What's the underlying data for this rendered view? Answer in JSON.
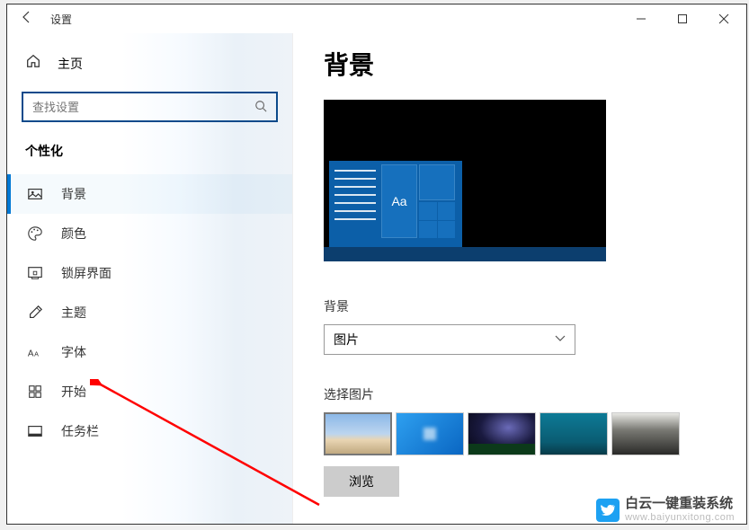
{
  "titlebar": {
    "title": "设置"
  },
  "sidebar": {
    "home": "主页",
    "search_placeholder": "查找设置",
    "group": "个性化",
    "items": [
      {
        "label": "背景"
      },
      {
        "label": "颜色"
      },
      {
        "label": "锁屏界面"
      },
      {
        "label": "主题"
      },
      {
        "label": "字体"
      },
      {
        "label": "开始"
      },
      {
        "label": "任务栏"
      }
    ]
  },
  "content": {
    "title": "背景",
    "bg_label": "背景",
    "dropdown_value": "图片",
    "choose_label": "选择图片",
    "browse": "浏览",
    "preview_tile_text": "Aa"
  },
  "watermark": {
    "title": "白云一键重装系统",
    "url": "www.baiyunxitong.com"
  }
}
